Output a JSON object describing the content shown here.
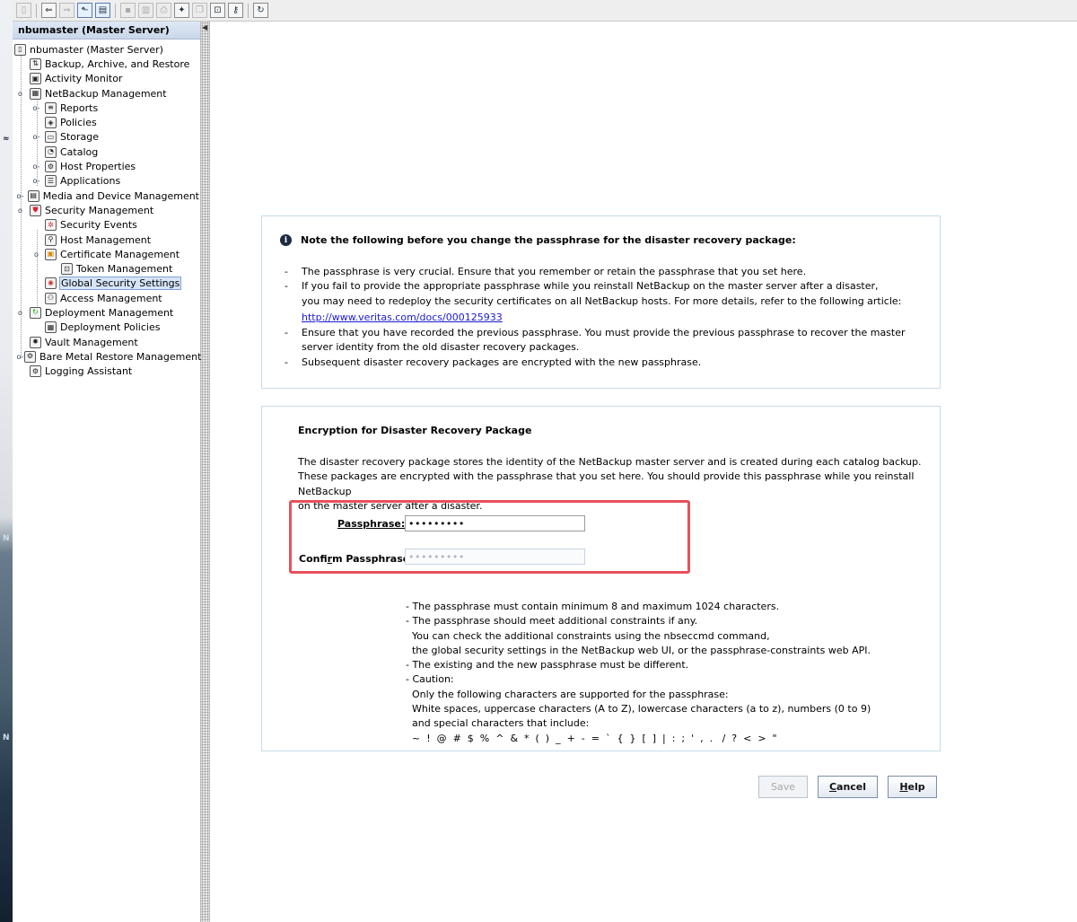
{
  "nav": {
    "header": "nbumaster (Master Server)",
    "items": [
      {
        "label": "nbumaster (Master Server)",
        "icon": "server-icon",
        "level": 0
      },
      {
        "label": "Backup, Archive, and Restore",
        "icon": "backup-icon",
        "level": 1
      },
      {
        "label": "Activity Monitor",
        "icon": "monitor-icon",
        "level": 1
      },
      {
        "label": "NetBackup Management",
        "icon": "netbackup-icon",
        "level": 1
      },
      {
        "label": "Reports",
        "icon": "reports-icon",
        "level": 2
      },
      {
        "label": "Policies",
        "icon": "policies-icon",
        "level": 2
      },
      {
        "label": "Storage",
        "icon": "storage-icon",
        "level": 2
      },
      {
        "label": "Catalog",
        "icon": "catalog-icon",
        "level": 2
      },
      {
        "label": "Host Properties",
        "icon": "host-properties-icon",
        "level": 2
      },
      {
        "label": "Applications",
        "icon": "applications-icon",
        "level": 2
      },
      {
        "label": "Media and Device Management",
        "icon": "media-device-icon",
        "level": 1
      },
      {
        "label": "Security Management",
        "icon": "security-icon",
        "level": 1
      },
      {
        "label": "Security Events",
        "icon": "security-events-icon",
        "level": 2
      },
      {
        "label": "Host Management",
        "icon": "host-management-icon",
        "level": 2
      },
      {
        "label": "Certificate Management",
        "icon": "certificate-icon",
        "level": 2
      },
      {
        "label": "Token Management",
        "icon": "token-icon",
        "level": 3
      },
      {
        "label": "Global Security Settings",
        "icon": "global-security-icon",
        "level": 2
      },
      {
        "label": "Access Management",
        "icon": "access-management-icon",
        "level": 2
      },
      {
        "label": "Deployment Management",
        "icon": "deployment-icon",
        "level": 1
      },
      {
        "label": "Deployment Policies",
        "icon": "deployment-policies-icon",
        "level": 2
      },
      {
        "label": "Vault Management",
        "icon": "vault-icon",
        "level": 1
      },
      {
        "label": "Bare Metal Restore Management",
        "icon": "bare-metal-icon",
        "level": 1
      },
      {
        "label": "Logging Assistant",
        "icon": "logging-icon",
        "level": 1
      }
    ],
    "selected": "Global Security Settings"
  },
  "note": {
    "heading": "Note the following before you change the passphrase for the disaster recovery package:",
    "bullet1": "The passphrase is very crucial. Ensure that you remember or retain the passphrase that you set here.",
    "bullet2_line1": "If you fail to provide the appropriate passphrase while you reinstall NetBackup on the master server after a disaster,",
    "bullet2_line2": "you may need to redeploy the security certificates on all NetBackup hosts. For more details, refer to the following article:",
    "link": "http://www.veritas.com/docs/000125933",
    "bullet3_line1": "Ensure that you have recorded the previous passphrase. You must provide the previous passphrase to recover the master",
    "bullet3_line2": "server identity from the old disaster recovery packages.",
    "bullet4": "Subsequent disaster recovery packages are encrypted with the new passphrase."
  },
  "encryption": {
    "title": "Encryption for Disaster Recovery Package",
    "desc_line1": "The disaster recovery package stores the identity of the NetBackup master server and is created during each catalog backup.",
    "desc_line2": "These packages are encrypted with the passphrase that you set here. You should provide this passphrase while you reinstall NetBackup",
    "desc_line3": "on the master server after a disaster.",
    "passphrase_label": "Passphrase:",
    "passphrase_value": "•••••••••",
    "confirm_label_pre": "Confi",
    "confirm_label_mnemonic": "r",
    "confirm_label_post": "m Passphrase:",
    "confirm_value": "•••••••••",
    "rules": [
      "- The passphrase must contain minimum 8 and maximum 1024 characters.",
      "- The passphrase should meet additional constraints if any.",
      "  You can check the additional constraints using the nbseccmd command,",
      "  the global security settings in the NetBackup web UI, or the passphrase-constraints web API.",
      "- The existing and the new passphrase must be different.",
      "- Caution:",
      "  Only the following characters are supported for the passphrase:",
      "  White spaces, uppercase characters (A to Z), lowercase characters (a to z), numbers (0 to 9)",
      "  and special characters that include:",
      "  ~  !  @  #  $  %  ^  &  *  (  )  _  +  -  =  `  {  }  [  ]  |  :  ;  '  ,  .   /  ?  <  >  \""
    ]
  },
  "buttons": {
    "save": "Save",
    "cancel_mnemonic": "C",
    "cancel_rest": "ancel",
    "help_mnemonic": "H",
    "help_rest": "elp"
  }
}
